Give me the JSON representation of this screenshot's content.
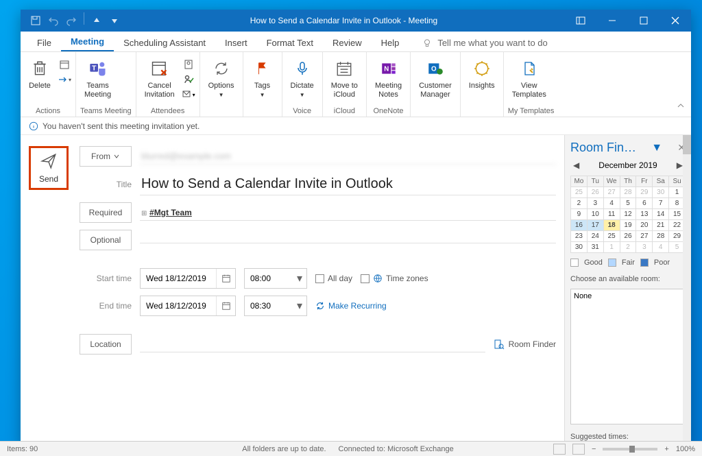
{
  "titlebar": {
    "title": "How to Send a Calendar Invite in Outlook  -  Meeting"
  },
  "menu": {
    "file": "File",
    "meeting": "Meeting",
    "scheduling": "Scheduling Assistant",
    "insert": "Insert",
    "format": "Format Text",
    "review": "Review",
    "help": "Help",
    "tell_me": "Tell me what you want to do"
  },
  "ribbon": {
    "delete": "Delete",
    "actions": "Actions",
    "teams": "Teams\nMeeting",
    "teams_group": "Teams Meeting",
    "cancel": "Cancel\nInvitation",
    "attendees": "Attendees",
    "options": "Options",
    "tags": "Tags",
    "dictate": "Dictate",
    "voice": "Voice",
    "icloud": "Move to\niCloud",
    "icloud_group": "iCloud",
    "mnotes": "Meeting\nNotes",
    "onenote": "OneNote",
    "cust": "Customer\nManager",
    "insights": "Insights",
    "view_tpl": "View\nTemplates",
    "mytpl": "My Templates"
  },
  "infobar": {
    "text": "You haven't sent this meeting invitation yet."
  },
  "form": {
    "send": "Send",
    "from": "From",
    "from_value": "blurred@example.com",
    "title_label": "Title",
    "title_value": "How to Send a Calendar Invite in Outlook",
    "required": "Required",
    "required_value": "#Mgt Team",
    "optional": "Optional",
    "start": "Start time",
    "end": "End time",
    "start_date": "Wed 18/12/2019",
    "start_time": "08:00",
    "end_date": "Wed 18/12/2019",
    "end_time": "08:30",
    "allday": "All day",
    "tz": "Time zones",
    "recur": "Make Recurring",
    "location": "Location",
    "room_finder": "Room Finder"
  },
  "room": {
    "title": "Room Fin…",
    "month": "December 2019",
    "hdr": [
      "Mo",
      "Tu",
      "We",
      "Th",
      "Fr",
      "Sa",
      "Su"
    ],
    "weeks": [
      [
        {
          "d": 25,
          "m": 1
        },
        {
          "d": 26,
          "m": 1
        },
        {
          "d": 27,
          "m": 1
        },
        {
          "d": 28,
          "m": 1
        },
        {
          "d": 29,
          "m": 1
        },
        {
          "d": 30,
          "m": 1
        },
        {
          "d": 1
        }
      ],
      [
        {
          "d": 2
        },
        {
          "d": 3
        },
        {
          "d": 4
        },
        {
          "d": 5
        },
        {
          "d": 6
        },
        {
          "d": 7
        },
        {
          "d": 8
        }
      ],
      [
        {
          "d": 9
        },
        {
          "d": 10
        },
        {
          "d": 11
        },
        {
          "d": 12
        },
        {
          "d": 13
        },
        {
          "d": 14
        },
        {
          "d": 15
        }
      ],
      [
        {
          "d": 16,
          "s": 1
        },
        {
          "d": 17,
          "s": 1
        },
        {
          "d": 18,
          "h": 1
        },
        {
          "d": 19
        },
        {
          "d": 20
        },
        {
          "d": 21
        },
        {
          "d": 22
        }
      ],
      [
        {
          "d": 23
        },
        {
          "d": 24
        },
        {
          "d": 25
        },
        {
          "d": 26
        },
        {
          "d": 27
        },
        {
          "d": 28
        },
        {
          "d": 29
        }
      ],
      [
        {
          "d": 30
        },
        {
          "d": 31
        },
        {
          "d": 1,
          "m": 1
        },
        {
          "d": 2,
          "m": 1
        },
        {
          "d": 3,
          "m": 1
        },
        {
          "d": 4,
          "m": 1
        },
        {
          "d": 5,
          "m": 1
        }
      ]
    ],
    "good": "Good",
    "fair": "Fair",
    "poor": "Poor",
    "choose": "Choose an available room:",
    "none": "None",
    "suggested": "Suggested times:"
  },
  "status": {
    "items": "Items: 90",
    "upto": "All folders are up to date.",
    "conn": "Connected to: Microsoft Exchange",
    "zoom": "100%"
  }
}
